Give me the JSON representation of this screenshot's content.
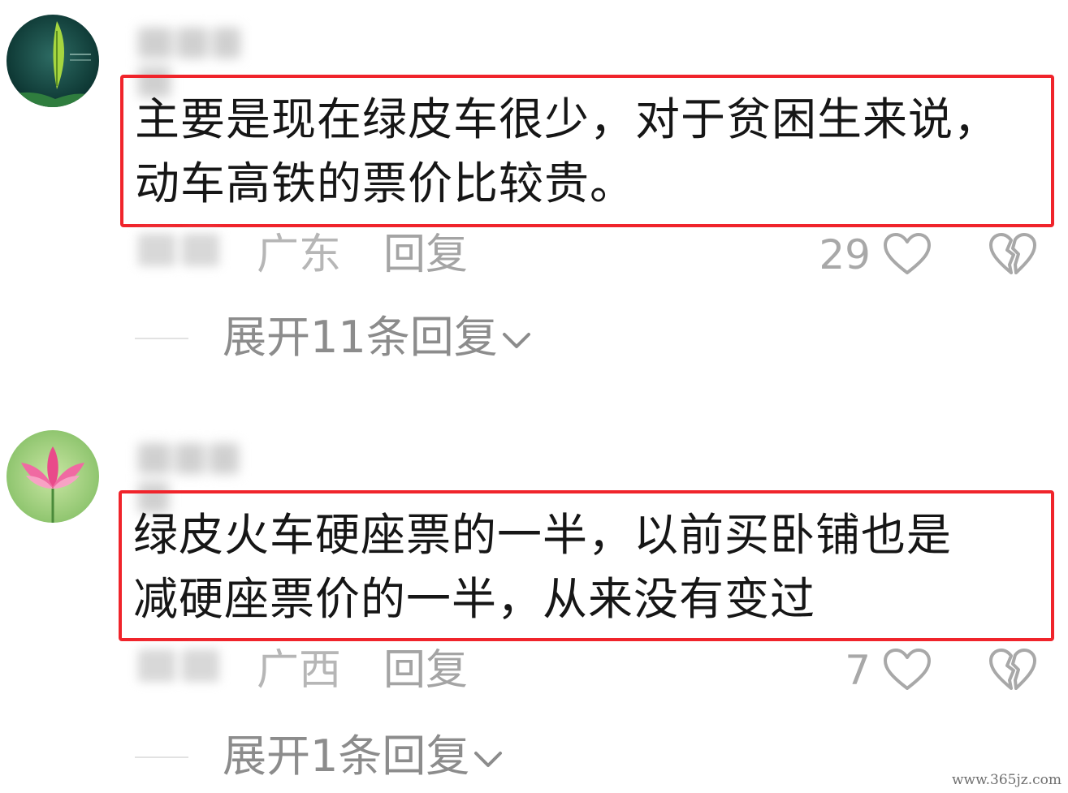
{
  "comments": [
    {
      "content": "主要是现在绿皮车很少，对于贫困生来说，\n动车高铁的票价比较贵。",
      "region": "广东",
      "reply_label": "回复",
      "likes": "29",
      "expand_label": "展开11条回复"
    },
    {
      "content": "绿皮火车硬座票的一半，以前买卧铺也是\n减硬座票价的一半，从来没有变过",
      "region": "广西",
      "reply_label": "回复",
      "likes": "7",
      "expand_label": "展开1条回复"
    }
  ],
  "watermark": "www.365jz.com",
  "colors": {
    "highlight_border": "#f0242b",
    "meta_text": "#b6b6b6",
    "expand_text": "#8c8c8c"
  },
  "icons": {
    "like": "heart-outline-icon",
    "dislike": "broken-heart-icon",
    "expand": "chevron-down-icon"
  }
}
